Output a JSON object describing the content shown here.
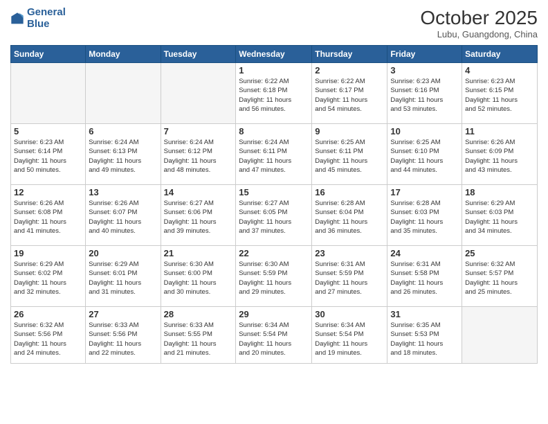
{
  "logo": {
    "line1": "General",
    "line2": "Blue"
  },
  "title": "October 2025",
  "location": "Lubu, Guangdong, China",
  "days_of_week": [
    "Sunday",
    "Monday",
    "Tuesday",
    "Wednesday",
    "Thursday",
    "Friday",
    "Saturday"
  ],
  "weeks": [
    [
      {
        "day": "",
        "info": ""
      },
      {
        "day": "",
        "info": ""
      },
      {
        "day": "",
        "info": ""
      },
      {
        "day": "1",
        "info": "Sunrise: 6:22 AM\nSunset: 6:18 PM\nDaylight: 11 hours\nand 56 minutes."
      },
      {
        "day": "2",
        "info": "Sunrise: 6:22 AM\nSunset: 6:17 PM\nDaylight: 11 hours\nand 54 minutes."
      },
      {
        "day": "3",
        "info": "Sunrise: 6:23 AM\nSunset: 6:16 PM\nDaylight: 11 hours\nand 53 minutes."
      },
      {
        "day": "4",
        "info": "Sunrise: 6:23 AM\nSunset: 6:15 PM\nDaylight: 11 hours\nand 52 minutes."
      }
    ],
    [
      {
        "day": "5",
        "info": "Sunrise: 6:23 AM\nSunset: 6:14 PM\nDaylight: 11 hours\nand 50 minutes."
      },
      {
        "day": "6",
        "info": "Sunrise: 6:24 AM\nSunset: 6:13 PM\nDaylight: 11 hours\nand 49 minutes."
      },
      {
        "day": "7",
        "info": "Sunrise: 6:24 AM\nSunset: 6:12 PM\nDaylight: 11 hours\nand 48 minutes."
      },
      {
        "day": "8",
        "info": "Sunrise: 6:24 AM\nSunset: 6:11 PM\nDaylight: 11 hours\nand 47 minutes."
      },
      {
        "day": "9",
        "info": "Sunrise: 6:25 AM\nSunset: 6:11 PM\nDaylight: 11 hours\nand 45 minutes."
      },
      {
        "day": "10",
        "info": "Sunrise: 6:25 AM\nSunset: 6:10 PM\nDaylight: 11 hours\nand 44 minutes."
      },
      {
        "day": "11",
        "info": "Sunrise: 6:26 AM\nSunset: 6:09 PM\nDaylight: 11 hours\nand 43 minutes."
      }
    ],
    [
      {
        "day": "12",
        "info": "Sunrise: 6:26 AM\nSunset: 6:08 PM\nDaylight: 11 hours\nand 41 minutes."
      },
      {
        "day": "13",
        "info": "Sunrise: 6:26 AM\nSunset: 6:07 PM\nDaylight: 11 hours\nand 40 minutes."
      },
      {
        "day": "14",
        "info": "Sunrise: 6:27 AM\nSunset: 6:06 PM\nDaylight: 11 hours\nand 39 minutes."
      },
      {
        "day": "15",
        "info": "Sunrise: 6:27 AM\nSunset: 6:05 PM\nDaylight: 11 hours\nand 37 minutes."
      },
      {
        "day": "16",
        "info": "Sunrise: 6:28 AM\nSunset: 6:04 PM\nDaylight: 11 hours\nand 36 minutes."
      },
      {
        "day": "17",
        "info": "Sunrise: 6:28 AM\nSunset: 6:03 PM\nDaylight: 11 hours\nand 35 minutes."
      },
      {
        "day": "18",
        "info": "Sunrise: 6:29 AM\nSunset: 6:03 PM\nDaylight: 11 hours\nand 34 minutes."
      }
    ],
    [
      {
        "day": "19",
        "info": "Sunrise: 6:29 AM\nSunset: 6:02 PM\nDaylight: 11 hours\nand 32 minutes."
      },
      {
        "day": "20",
        "info": "Sunrise: 6:29 AM\nSunset: 6:01 PM\nDaylight: 11 hours\nand 31 minutes."
      },
      {
        "day": "21",
        "info": "Sunrise: 6:30 AM\nSunset: 6:00 PM\nDaylight: 11 hours\nand 30 minutes."
      },
      {
        "day": "22",
        "info": "Sunrise: 6:30 AM\nSunset: 5:59 PM\nDaylight: 11 hours\nand 29 minutes."
      },
      {
        "day": "23",
        "info": "Sunrise: 6:31 AM\nSunset: 5:59 PM\nDaylight: 11 hours\nand 27 minutes."
      },
      {
        "day": "24",
        "info": "Sunrise: 6:31 AM\nSunset: 5:58 PM\nDaylight: 11 hours\nand 26 minutes."
      },
      {
        "day": "25",
        "info": "Sunrise: 6:32 AM\nSunset: 5:57 PM\nDaylight: 11 hours\nand 25 minutes."
      }
    ],
    [
      {
        "day": "26",
        "info": "Sunrise: 6:32 AM\nSunset: 5:56 PM\nDaylight: 11 hours\nand 24 minutes."
      },
      {
        "day": "27",
        "info": "Sunrise: 6:33 AM\nSunset: 5:56 PM\nDaylight: 11 hours\nand 22 minutes."
      },
      {
        "day": "28",
        "info": "Sunrise: 6:33 AM\nSunset: 5:55 PM\nDaylight: 11 hours\nand 21 minutes."
      },
      {
        "day": "29",
        "info": "Sunrise: 6:34 AM\nSunset: 5:54 PM\nDaylight: 11 hours\nand 20 minutes."
      },
      {
        "day": "30",
        "info": "Sunrise: 6:34 AM\nSunset: 5:54 PM\nDaylight: 11 hours\nand 19 minutes."
      },
      {
        "day": "31",
        "info": "Sunrise: 6:35 AM\nSunset: 5:53 PM\nDaylight: 11 hours\nand 18 minutes."
      },
      {
        "day": "",
        "info": ""
      }
    ]
  ]
}
